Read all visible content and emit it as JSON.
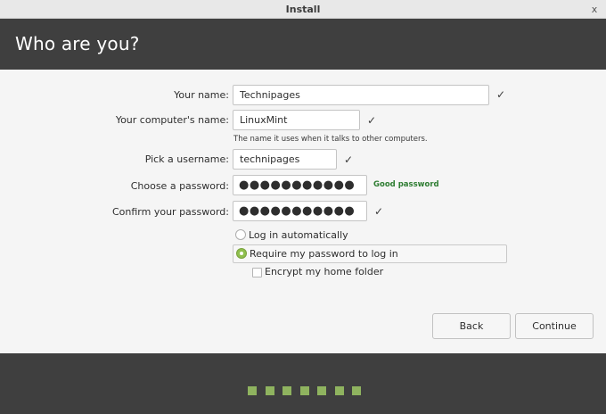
{
  "window": {
    "title": "Install",
    "close_glyph": "x"
  },
  "header": {
    "title": "Who are you?"
  },
  "form": {
    "name": {
      "label": "Your name:",
      "value": "Technipages"
    },
    "computer": {
      "label": "Your computer's name:",
      "value": "LinuxMint",
      "hint": "The name it uses when it talks to other computers."
    },
    "username": {
      "label": "Pick a username:",
      "value": "technipages"
    },
    "password": {
      "label": "Choose a password:",
      "value": "●●●●●●●●●●●",
      "strength": "Good password"
    },
    "confirm": {
      "label": "Confirm your password:",
      "value": "●●●●●●●●●●●"
    },
    "check_glyph": "✓"
  },
  "login": {
    "auto_label": "Log in automatically",
    "require_label": "Require my password to log in",
    "encrypt_label": "Encrypt my home folder",
    "selected": "require"
  },
  "buttons": {
    "back": "Back",
    "continue": "Continue"
  },
  "progress": {
    "total_steps": 7
  },
  "colors": {
    "accent": "#8fbf4e",
    "header_bg": "#3f3f3f",
    "good_password": "#2e7d32"
  }
}
